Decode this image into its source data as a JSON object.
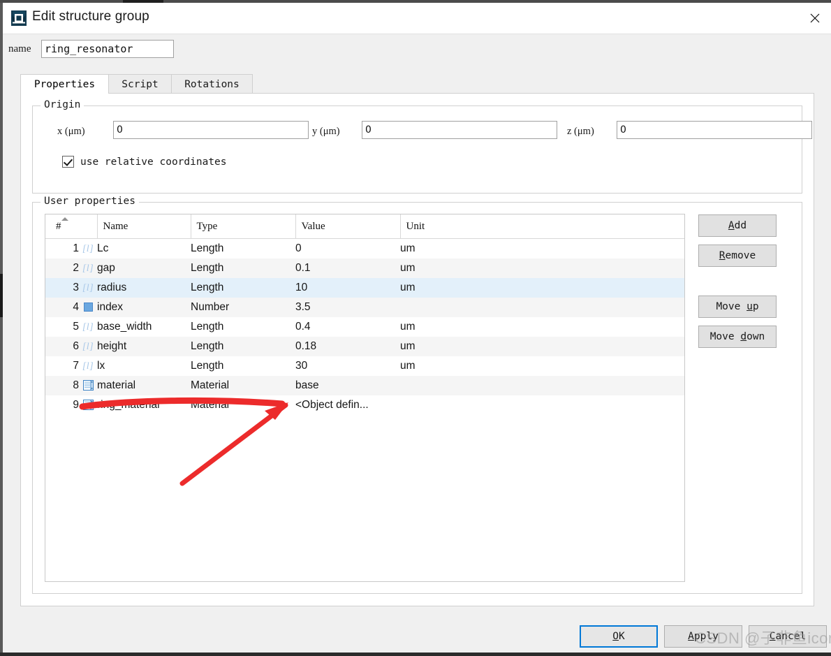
{
  "window": {
    "title": "Edit structure group",
    "icon": "lumerical-app-icon",
    "close_label": "✕"
  },
  "name_field": {
    "label": "name",
    "value": "ring_resonator",
    "placeholder": ""
  },
  "tabs": [
    {
      "label": "Properties",
      "active": true
    },
    {
      "label": "Script",
      "active": false
    },
    {
      "label": "Rotations",
      "active": false
    }
  ],
  "origin": {
    "title": "Origin",
    "fields": [
      {
        "label": "x (μm)",
        "value": "0"
      },
      {
        "label": "y (μm)",
        "value": "0"
      },
      {
        "label": "z (μm)",
        "value": "0"
      }
    ],
    "relative_checkbox": {
      "label": "use relative coordinates",
      "checked": true
    }
  },
  "user_properties": {
    "title": "User properties",
    "columns": [
      "#",
      "Name",
      "Type",
      "Value",
      "Unit"
    ],
    "sort_indicator": "ascending-caret",
    "rows": [
      {
        "index": "1",
        "icon": "length-icon",
        "name": "Lc",
        "type": "Length",
        "value": "0",
        "unit": "um",
        "selected": false
      },
      {
        "index": "2",
        "icon": "length-icon",
        "name": "gap",
        "type": "Length",
        "value": "0.1",
        "unit": "um",
        "selected": false
      },
      {
        "index": "3",
        "icon": "length-icon",
        "name": "radius",
        "type": "Length",
        "value": "10",
        "unit": "um",
        "selected": true
      },
      {
        "index": "4",
        "icon": "number-icon",
        "name": "index",
        "type": "Number",
        "value": "3.5",
        "unit": "",
        "selected": false
      },
      {
        "index": "5",
        "icon": "length-icon",
        "name": "base_width",
        "type": "Length",
        "value": "0.4",
        "unit": "um",
        "selected": false
      },
      {
        "index": "6",
        "icon": "length-icon",
        "name": "height",
        "type": "Length",
        "value": "0.18",
        "unit": "um",
        "selected": false
      },
      {
        "index": "7",
        "icon": "length-icon",
        "name": "lx",
        "type": "Length",
        "value": "30",
        "unit": "um",
        "selected": false
      },
      {
        "index": "8",
        "icon": "material-icon",
        "name": "material",
        "type": "Material",
        "value": "base",
        "unit": "",
        "selected": false
      },
      {
        "index": "9",
        "icon": "material-icon",
        "name": "ring_material",
        "type": "Material",
        "value": "<Object defin...",
        "unit": "",
        "selected": false
      }
    ],
    "side_buttons": [
      {
        "label": "Add",
        "mnemonic": "A",
        "name": "add-button"
      },
      {
        "label": "Remove",
        "mnemonic": "R",
        "name": "remove-button"
      },
      {
        "label": "Move up",
        "mnemonic": "u",
        "name": "move-up-button"
      },
      {
        "label": "Move down",
        "mnemonic": "d",
        "name": "move-down-button"
      }
    ]
  },
  "footer_buttons": [
    {
      "label": "OK",
      "mnemonic": "O",
      "default": true
    },
    {
      "label": "Apply",
      "mnemonic": "A",
      "default": false
    },
    {
      "label": "Cancel",
      "mnemonic": "C",
      "default": false
    }
  ],
  "annotation": {
    "type": "red-arrow",
    "color": "#ec2b2b",
    "points_to": "value-column-of-material-rows"
  },
  "watermark": {
    "text": "CSDN @子非鱼icon",
    "color": "#969696"
  }
}
